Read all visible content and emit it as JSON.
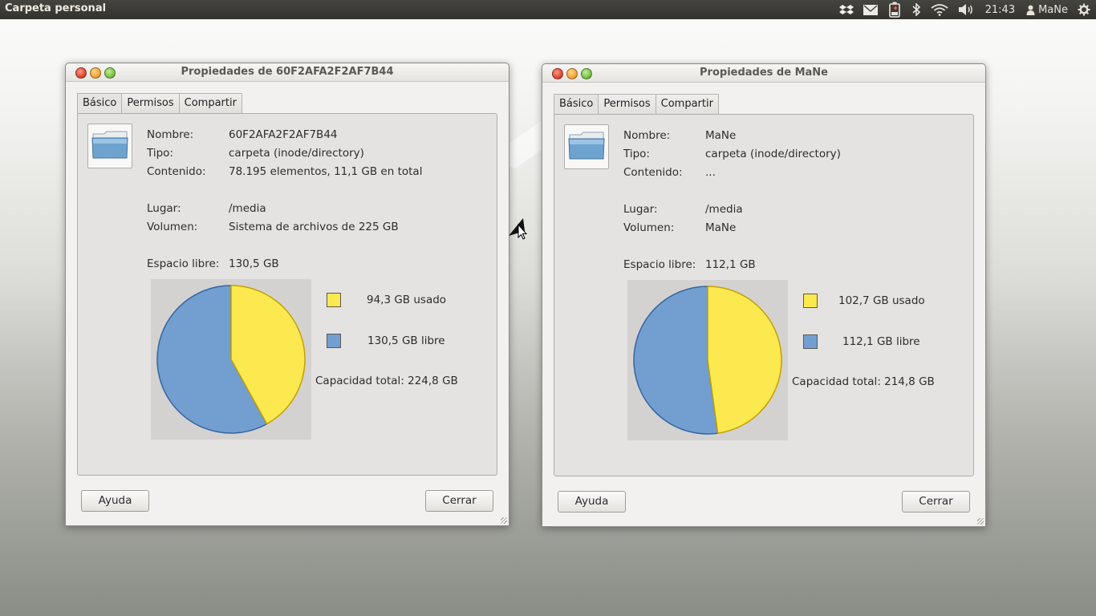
{
  "panel": {
    "title": "Carpeta personal",
    "clock": "21:43",
    "user": "MaNe",
    "icons": [
      "dropbox-icon",
      "mail-icon",
      "battery-icon",
      "bluetooth-icon",
      "wifi-icon",
      "volume-icon",
      "user-icon",
      "power-gear-icon"
    ]
  },
  "windows": [
    {
      "title": "Propiedades de 60F2AFA2F2AF7B44",
      "tabs": [
        "Básico",
        "Permisos",
        "Compartir"
      ],
      "active_tab": "Básico",
      "fields": {
        "nombre_label": "Nombre:",
        "nombre": "60F2AFA2F2AF7B44",
        "tipo_label": "Tipo:",
        "tipo": "carpeta (inode/directory)",
        "contenido_label": "Contenido:",
        "contenido": "78.195 elementos, 11,1 GB en total",
        "lugar_label": "Lugar:",
        "lugar": "/media",
        "volumen_label": "Volumen:",
        "volumen": "Sistema de archivos de 225 GB",
        "espacio_label": "Espacio libre:",
        "espacio": "130,5 GB"
      },
      "legend": {
        "used": "94,3 GB usado",
        "free": "130,5 GB libre",
        "total": "Capacidad total: 224,8 GB"
      },
      "usage": {
        "used_gb": 94.3,
        "free_gb": 130.5
      },
      "buttons": {
        "help": "Ayuda",
        "close": "Cerrar"
      }
    },
    {
      "title": "Propiedades de MaNe",
      "tabs": [
        "Básico",
        "Permisos",
        "Compartir"
      ],
      "active_tab": "Básico",
      "fields": {
        "nombre_label": "Nombre:",
        "nombre": "MaNe",
        "tipo_label": "Tipo:",
        "tipo": "carpeta (inode/directory)",
        "contenido_label": "Contenido:",
        "contenido": "...",
        "lugar_label": "Lugar:",
        "lugar": "/media",
        "volumen_label": "Volumen:",
        "volumen": "MaNe",
        "espacio_label": "Espacio libre:",
        "espacio": "112,1 GB"
      },
      "legend": {
        "used": "102,7 GB usado",
        "free": "112,1 GB libre",
        "total": "Capacidad total: 214,8 GB"
      },
      "usage": {
        "used_gb": 102.7,
        "free_gb": 112.1
      },
      "buttons": {
        "help": "Ayuda",
        "close": "Cerrar"
      }
    }
  ],
  "colors": {
    "used": "#fce94f",
    "used_stroke": "#c4a000",
    "free": "#729fcf",
    "free_stroke": "#3465a4"
  }
}
